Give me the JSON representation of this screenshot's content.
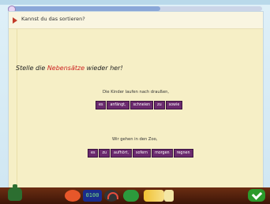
{
  "header": {
    "question": "Kannst du das sortieren?"
  },
  "task": {
    "title_prefix": "Stelle die ",
    "title_highlight": "Nebensätze",
    "title_suffix": " wieder her!"
  },
  "exercises": [
    {
      "sentence": "Die Kinder laufen nach draußen,",
      "tiles": [
        "es",
        "anfängt,",
        "schneien",
        "zu",
        "sowie"
      ]
    },
    {
      "sentence": "Wir gehen in den Zoo,",
      "tiles": [
        "es",
        "zu",
        "aufhört,",
        "sofern",
        "morgen",
        "regnen"
      ]
    }
  ],
  "toolbar": {
    "clock_text": "0100"
  },
  "colors": {
    "tile_bg": "#6b2a6e",
    "highlight": "#cc1f1f",
    "paper": "#f6efc6",
    "toolbar": "#6b2d12"
  }
}
